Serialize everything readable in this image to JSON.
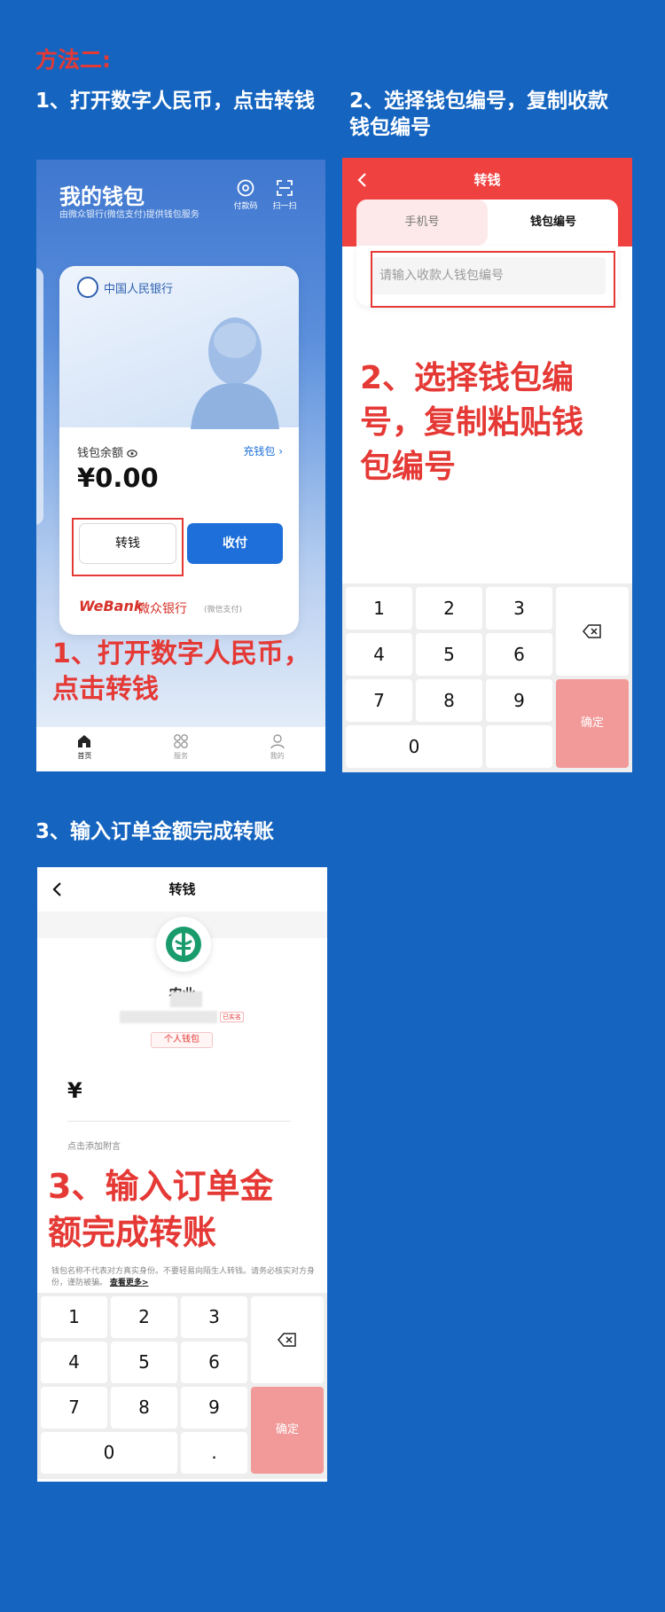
{
  "page": {
    "method_title": "方法二:",
    "step1_heading": "1、打开数字人民币，点击转钱",
    "step2_heading_line1": "2、选择钱包编号，复制收款",
    "step2_heading_line2": "钱包编号",
    "step3_heading": "3、输入订单金额完成转账"
  },
  "panel1": {
    "title": "我的钱包",
    "subtitle": "由微众银行(微信支付)提供钱包服务",
    "toolbar": {
      "pay_label": "付款码",
      "scan_label": "扫一扫"
    },
    "card": {
      "bank_name": "中国人民银行",
      "balance_label": "钱包余额",
      "recharge_label": "充钱包",
      "balance": "¥0.00",
      "transfer_label": "转钱",
      "receive_label": "收付",
      "brand_webank": "WeBank",
      "brand_cn": "微众银行",
      "brand_sub": "(微信支付)"
    },
    "annotation_line1": "1、打开数字人民币，",
    "annotation_line2": "点击转钱",
    "tabbar": {
      "home": "首页",
      "services": "服务",
      "mine": "我的"
    }
  },
  "panel2": {
    "nav_title": "转钱",
    "tab_phone": "手机号",
    "tab_wallet": "钱包编号",
    "input_placeholder": "请输入收款人钱包编号",
    "annotation_line1": "2、选择钱包编",
    "annotation_line2": "号，复制粘贴钱",
    "annotation_line3": "包编号",
    "keypad": {
      "k1": "1",
      "k2": "2",
      "k3": "3",
      "k4": "4",
      "k5": "5",
      "k6": "6",
      "k7": "7",
      "k8": "8",
      "k9": "9",
      "k0": "0",
      "confirm": "确定"
    }
  },
  "panel3": {
    "nav_title": "转钱",
    "receiver_name": "农业",
    "verified_label": "已实名",
    "wallet_type": "个人钱包",
    "currency_symbol": "¥",
    "attach_note": "点击添加附言",
    "annotation_line1": "3、输入订单金",
    "annotation_line2": "额完成转账",
    "notice_text": "钱包名称不代表对方真实身份。不要轻易向陌生人转钱。请务必核实对方身份，谨防被骗。",
    "notice_more": "查看更多>",
    "keypad": {
      "k1": "1",
      "k2": "2",
      "k3": "3",
      "k4": "4",
      "k5": "5",
      "k6": "6",
      "k7": "7",
      "k8": "8",
      "k9": "9",
      "k0": "0",
      "dot": ".",
      "confirm": "确定"
    }
  },
  "colors": {
    "background": "#1565c0",
    "annotation_red": "#e53935",
    "primary_blue": "#1e6fd9",
    "confirm_pink": "#f29a9a",
    "header_red": "#f04141"
  },
  "icons": {
    "back": "chevron-left-icon",
    "backspace": "backspace-icon",
    "pay_code": "qr-code-icon",
    "scan": "scan-icon",
    "eye": "eye-icon",
    "home": "home-icon",
    "services": "grid-icon",
    "mine": "user-icon",
    "bank_logo": "abc-bank-logo"
  }
}
